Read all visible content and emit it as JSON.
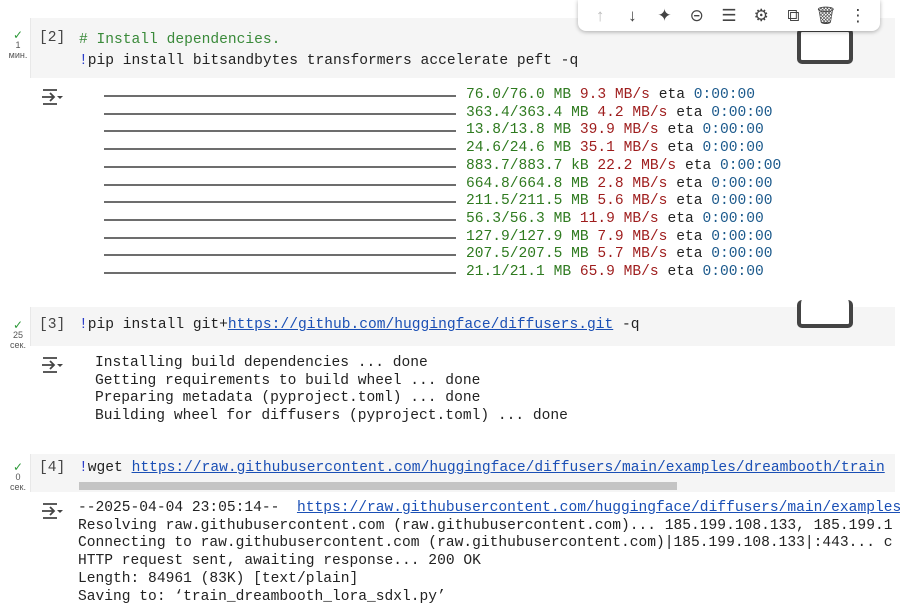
{
  "toolbar": {
    "items": [
      "move-up",
      "move-down",
      "gemini",
      "link",
      "comment",
      "settings",
      "mirror",
      "delete",
      "more"
    ]
  },
  "cells": [
    {
      "exec": "[2]",
      "status_num": "1",
      "status_unit": "мин.",
      "comment": "# Install dependencies.",
      "bang": "!",
      "code": "pip install bitsandbytes transformers accelerate peft -q",
      "progress": [
        {
          "size": "76.0/76.0 MB",
          "speed": "9.3 MB/s",
          "eta_label": "eta",
          "eta": "0:00:00"
        },
        {
          "size": "363.4/363.4 MB",
          "speed": "4.2 MB/s",
          "eta_label": "eta",
          "eta": "0:00:00"
        },
        {
          "size": "13.8/13.8 MB",
          "speed": "39.9 MB/s",
          "eta_label": "eta",
          "eta": "0:00:00"
        },
        {
          "size": "24.6/24.6 MB",
          "speed": "35.1 MB/s",
          "eta_label": "eta",
          "eta": "0:00:00"
        },
        {
          "size": "883.7/883.7 kB",
          "speed": "22.2 MB/s",
          "eta_label": "eta",
          "eta": "0:00:00"
        },
        {
          "size": "664.8/664.8 MB",
          "speed": "2.8 MB/s",
          "eta_label": "eta",
          "eta": "0:00:00"
        },
        {
          "size": "211.5/211.5 MB",
          "speed": "5.6 MB/s",
          "eta_label": "eta",
          "eta": "0:00:00"
        },
        {
          "size": "56.3/56.3 MB",
          "speed": "11.9 MB/s",
          "eta_label": "eta",
          "eta": "0:00:00"
        },
        {
          "size": "127.9/127.9 MB",
          "speed": "7.9 MB/s",
          "eta_label": "eta",
          "eta": "0:00:00"
        },
        {
          "size": "207.5/207.5 MB",
          "speed": "5.7 MB/s",
          "eta_label": "eta",
          "eta": "0:00:00"
        },
        {
          "size": "21.1/21.1 MB",
          "speed": "65.9 MB/s",
          "eta_label": "eta",
          "eta": "0:00:00"
        }
      ]
    },
    {
      "exec": "[3]",
      "status_num": "25",
      "status_unit": "сек.",
      "bang": "!",
      "code_pre": "pip install git+",
      "url": "https://github.com/huggingface/diffusers.git",
      "code_post": " -q",
      "output": [
        "Installing build dependencies ... done",
        "Getting requirements to build wheel ... done",
        "Preparing metadata (pyproject.toml) ... done",
        "Building wheel for diffusers (pyproject.toml) ... done"
      ]
    },
    {
      "exec": "[4]",
      "status_num": "0",
      "status_unit": "сек.",
      "bang": "!",
      "code_pre": "wget ",
      "url": "https://raw.githubusercontent.com/huggingface/diffusers/main/examples/dreambooth/train",
      "out_first_pre": "--2025-04-04 23:05:14--  ",
      "out_first_url": "https://raw.githubusercontent.com/huggingface/diffusers/main/examples",
      "output": [
        "Resolving raw.githubusercontent.com (raw.githubusercontent.com)... 185.199.108.133, 185.199.1",
        "Connecting to raw.githubusercontent.com (raw.githubusercontent.com)|185.199.108.133|:443... c",
        "HTTP request sent, awaiting response... 200 OK",
        "Length: 84961 (83K) [text/plain]",
        "Saving to: ‘train_dreambooth_lora_sdxl.py’"
      ]
    }
  ]
}
